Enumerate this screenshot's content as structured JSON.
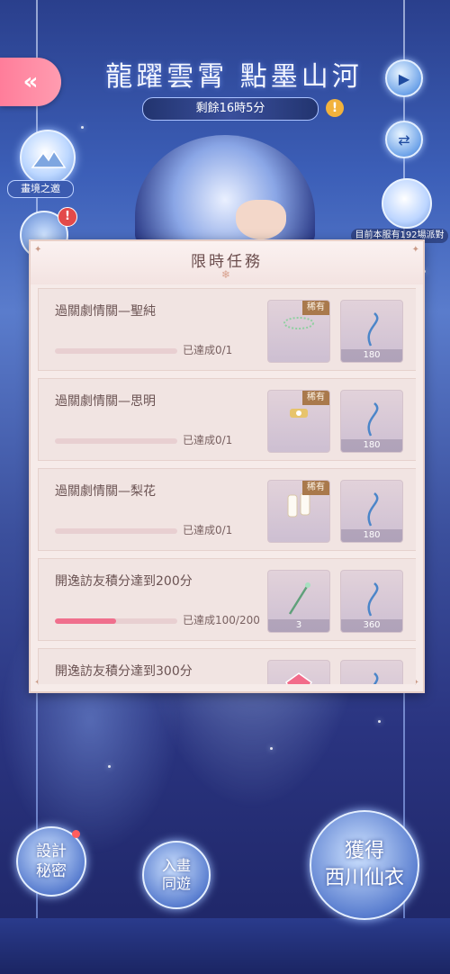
{
  "header": {
    "title": "龍躍雲霄 點墨山河",
    "timer": "剩餘16時5分",
    "warn_symbol": "!",
    "back_symbol": "«"
  },
  "side": {
    "dream_label": "畫境之邀",
    "alert_symbol": "!",
    "holdings_text": "目前本服有192場派對",
    "play_symbol": "▶",
    "swap_symbol": "⇄"
  },
  "panel": {
    "title": "限時任務",
    "tasks": [
      {
        "name": "過關劇情關—聖純",
        "progress": "已達成0/1",
        "fill": 0,
        "rewards": [
          {
            "tag": "稀有",
            "qty": "",
            "icon": "circlet-icon"
          },
          {
            "tag": "",
            "qty": "180",
            "icon": "hook-icon"
          }
        ]
      },
      {
        "name": "過關劇情關—思明",
        "progress": "已達成0/1",
        "fill": 0,
        "rewards": [
          {
            "tag": "稀有",
            "qty": "",
            "icon": "ornament-icon"
          },
          {
            "tag": "",
            "qty": "180",
            "icon": "hook-icon"
          }
        ]
      },
      {
        "name": "過關劇情關—梨花",
        "progress": "已達成0/1",
        "fill": 0,
        "rewards": [
          {
            "tag": "稀有",
            "qty": "",
            "icon": "slippers-icon"
          },
          {
            "tag": "",
            "qty": "180",
            "icon": "hook-icon"
          }
        ]
      },
      {
        "name": "開逸訪友積分達到200分",
        "progress": "已達成100/200",
        "fill": 0.5,
        "rewards": [
          {
            "tag": "",
            "qty": "3",
            "icon": "staff-icon"
          },
          {
            "tag": "",
            "qty": "360",
            "icon": "hook-icon"
          }
        ]
      },
      {
        "name": "開逸訪友積分達到300分",
        "progress": "",
        "fill": 0,
        "rewards": [
          {
            "tag": "",
            "qty": "",
            "icon": "gem-icon"
          },
          {
            "tag": "",
            "qty": "",
            "icon": "hook-icon"
          }
        ]
      }
    ]
  },
  "bottom": {
    "design_label": "設計\n秘密",
    "visit_label": "入畫\n同遊",
    "obtain_label": "獲得\n西川仙衣"
  },
  "colors": {
    "accent_pink": "#f06f8d",
    "panel_bg": "#f6ebe9",
    "rare_tag": "#a9794c"
  }
}
